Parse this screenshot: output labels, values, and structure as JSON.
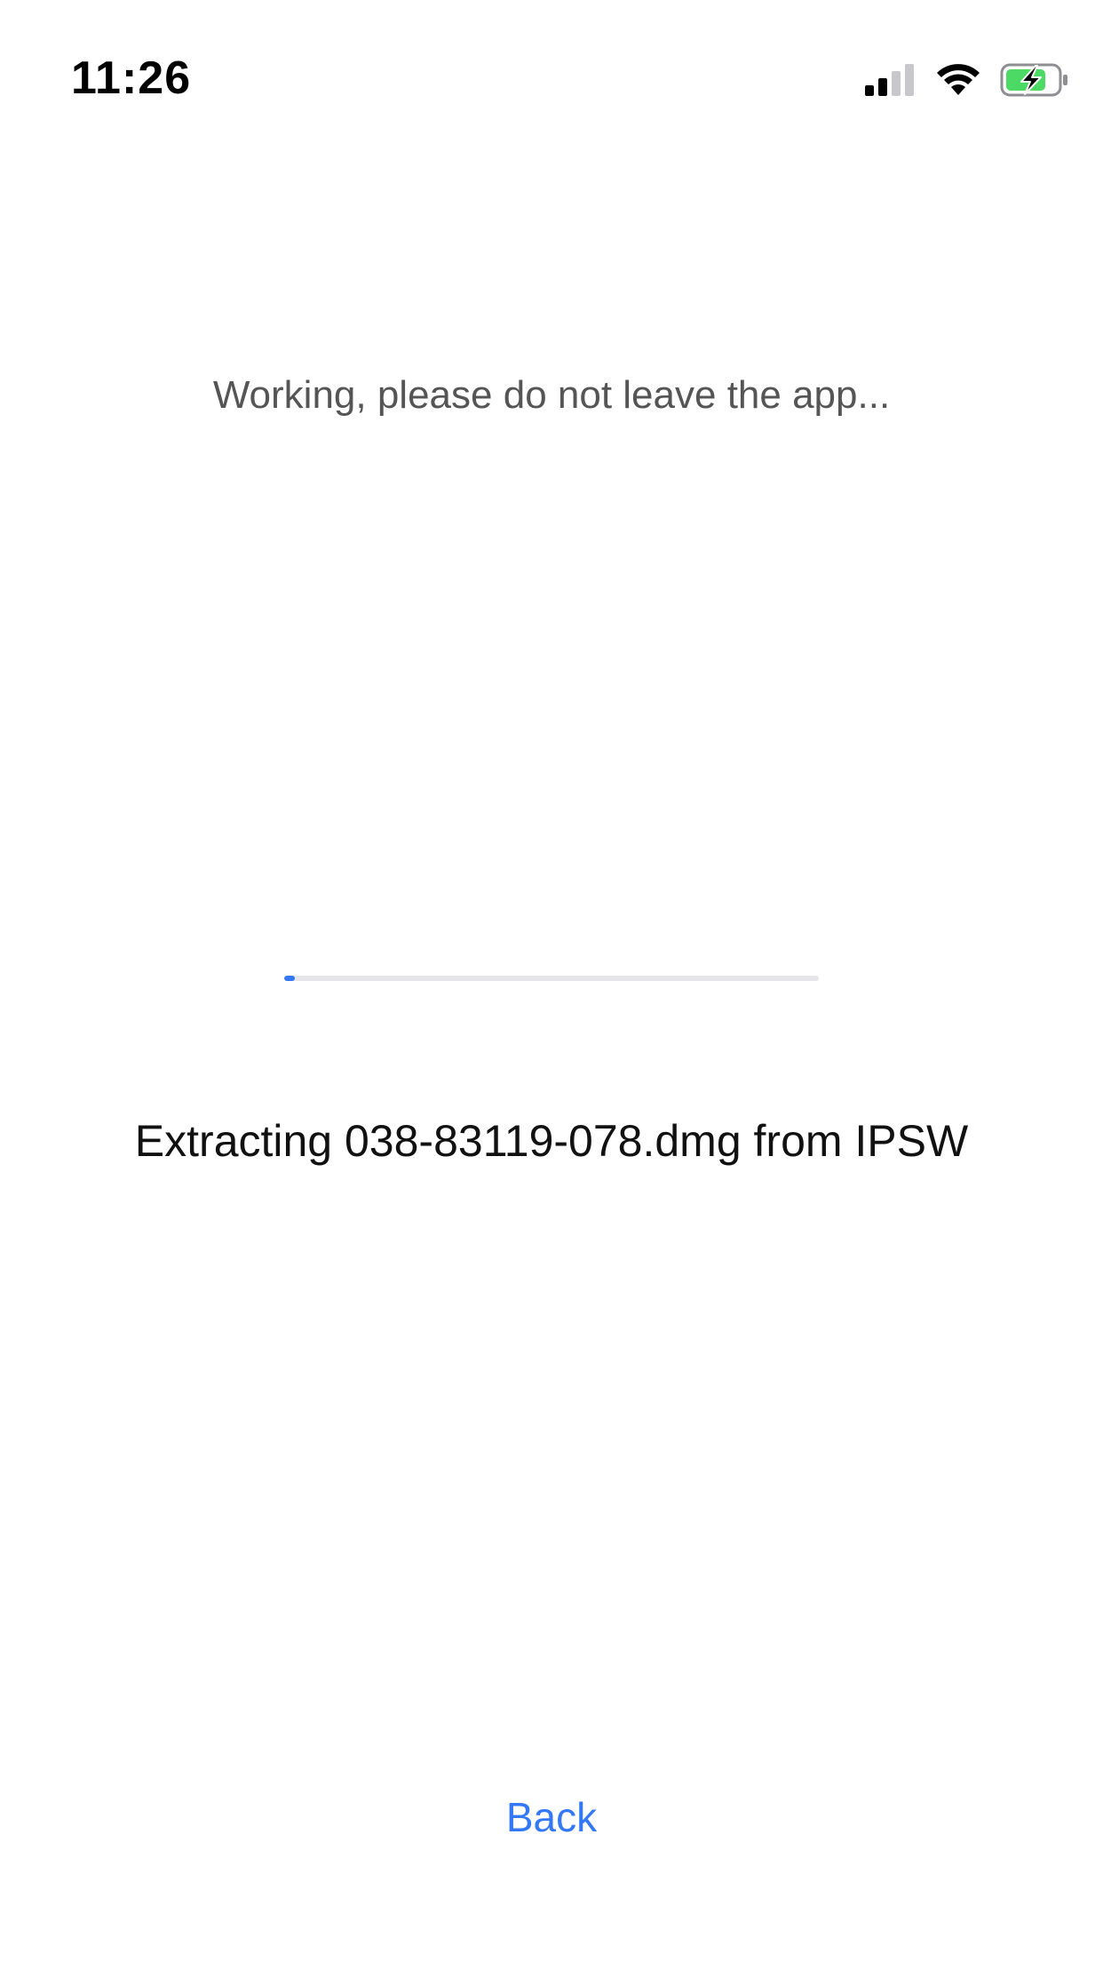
{
  "status_bar": {
    "time": "11:26",
    "icons": [
      "cellular-signal-icon",
      "wifi-icon",
      "battery-charging-icon"
    ],
    "battery_color": "#4cd964"
  },
  "main": {
    "working_message": "Working, please do not leave the app...",
    "progress_fraction": 0.02,
    "status_message": "Extracting 038-83119-078.dmg from IPSW"
  },
  "footer": {
    "back_label": "Back"
  },
  "colors": {
    "accent": "#3478f6",
    "track": "#e5e5ea"
  }
}
